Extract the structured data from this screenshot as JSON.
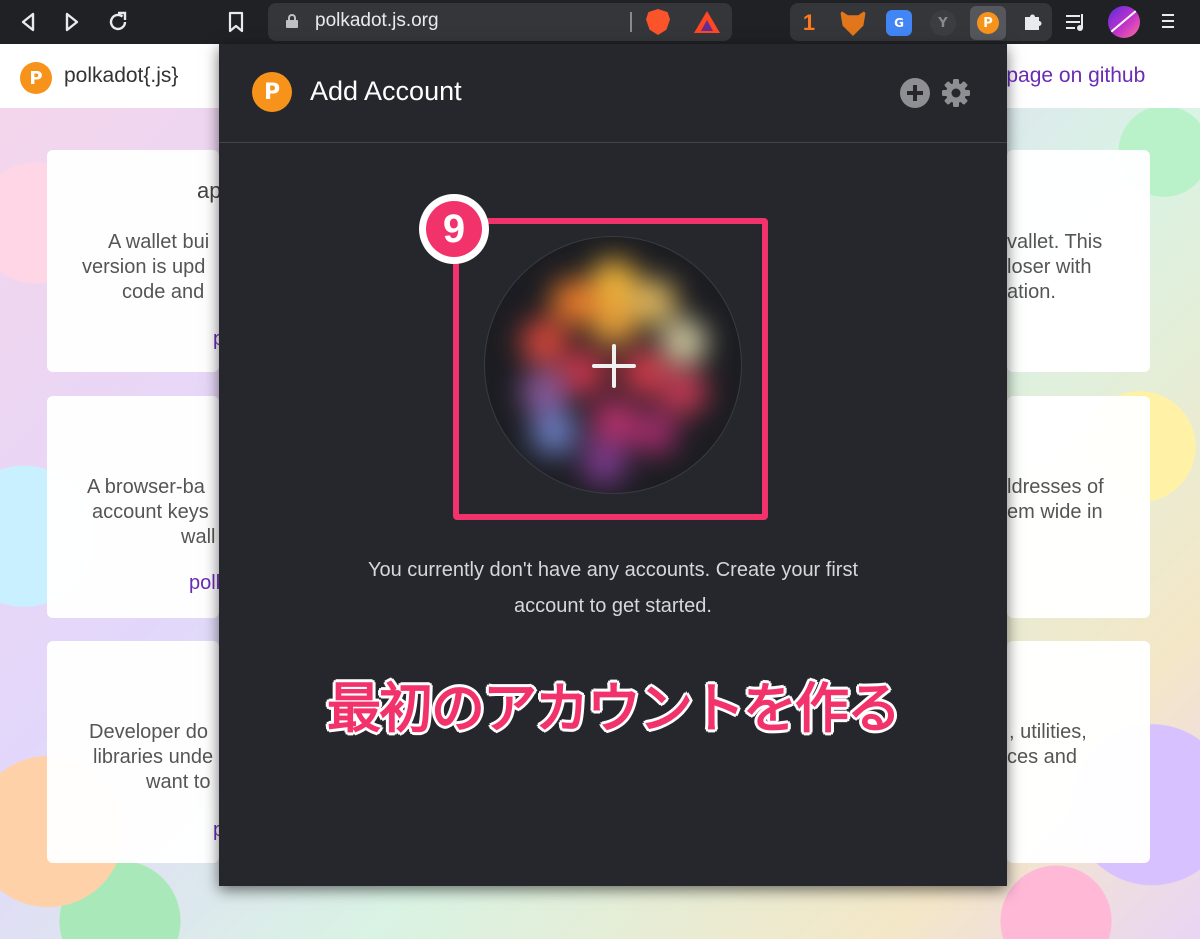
{
  "browser": {
    "url": "polkadot.js.org",
    "extensions": {
      "counter_badge": "1",
      "translate_label": "G",
      "yoroi_label": "Y",
      "polkadot_label": "P"
    }
  },
  "page": {
    "logo_label": "P",
    "site_title": "polkadot{.js}",
    "github_link": "it page on github",
    "cards": [
      {
        "title": "ap",
        "left_lines": [
          "A wallet bui",
          "version is upd",
          "code and"
        ],
        "right_lines": [
          "vallet. This",
          "loser with",
          "ation."
        ],
        "link": "p"
      },
      {
        "left_lines": [
          "A browser-ba",
          "account keys",
          "wall"
        ],
        "right_lines": [
          "ldresses of",
          "em wide in"
        ],
        "link": "polk"
      },
      {
        "left_lines": [
          "Developer do",
          "libraries unde",
          "want to"
        ],
        "right_lines": [
          ", utilities,",
          "ces and"
        ],
        "link": "p"
      }
    ]
  },
  "popup": {
    "logo_label": "P",
    "title": "Add Account",
    "empty_message_line1": "You currently don't have any accounts. Create your first",
    "empty_message_line2": "account to get started.",
    "step_number": "9",
    "caption": "最初のアカウントを作る"
  },
  "colors": {
    "accent_pink": "#f2336b",
    "polkadot_orange": "#f7931a",
    "popup_bg": "#26272c",
    "link_purple": "#6a2bb5"
  }
}
